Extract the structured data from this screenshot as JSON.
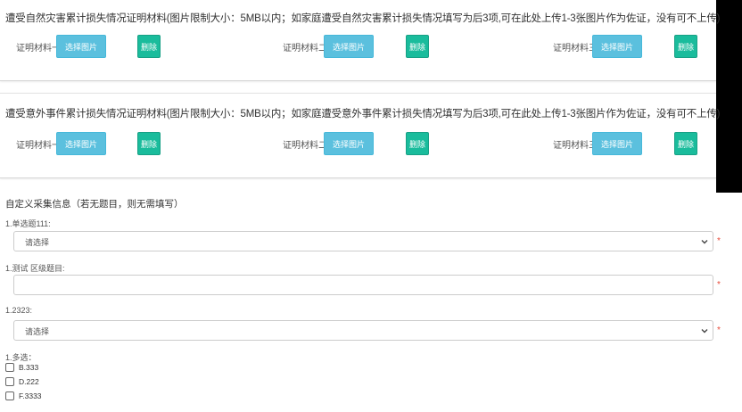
{
  "section1": {
    "title": "遭受自然灾害累计损失情况证明材料(图片限制大小：5MB以内；如家庭遭受自然灾害累计损失情况填写为后3项,可在此处上传1-3张图片作为佐证，没有可不上传)",
    "items": [
      {
        "label": "证明材料一：",
        "choose": "选择图片",
        "delete": "删除"
      },
      {
        "label": "证明材料二：",
        "choose": "选择图片",
        "delete": "删除"
      },
      {
        "label": "证明材料三：",
        "choose": "选择图片",
        "delete": "删除"
      }
    ]
  },
  "section2": {
    "title": "遭受意外事件累计损失情况证明材料(图片限制大小：5MB以内；如家庭遭受意外事件累计损失情况填写为后3项,可在此处上传1-3张图片作为佐证，没有可不上传)",
    "items": [
      {
        "label": "证明材料一：",
        "choose": "选择图片",
        "delete": "删除"
      },
      {
        "label": "证明材料二：",
        "choose": "选择图片",
        "delete": "删除"
      },
      {
        "label": "证明材料三：",
        "choose": "选择图片",
        "delete": "删除"
      }
    ]
  },
  "custom": {
    "title": "自定义采集信息（若无题目，则无需填写）",
    "questions": [
      {
        "label": "1.单选题111:",
        "type": "select",
        "value": "请选择",
        "required_mark": "*"
      },
      {
        "label": "1.测试 区级题目:",
        "type": "text",
        "value": "",
        "required_mark": "*"
      },
      {
        "label": "1.2323:",
        "type": "select",
        "value": "请选择",
        "required_mark": "*"
      }
    ],
    "multi": {
      "label": "1.多选：",
      "options": [
        "B.333",
        "D.222",
        "F.3333"
      ]
    }
  },
  "colors": {
    "choose_button": "#5bc0de",
    "delete_button": "#1abc9c",
    "required": "#e74c3c"
  }
}
